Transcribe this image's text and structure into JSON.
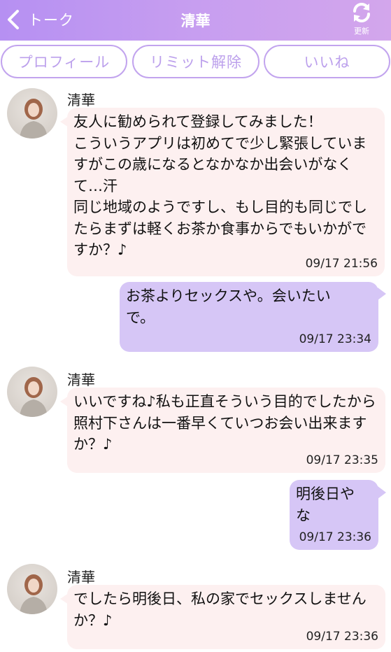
{
  "header": {
    "back_label": "トーク",
    "title": "清華",
    "refresh_label": "更新"
  },
  "tabs": {
    "profile": "プロフィール",
    "limit": "リミット解除",
    "like": "いいね"
  },
  "colors": {
    "header_gradient_start": "#b690f2",
    "header_gradient_end": "#d3a6ec",
    "incoming_bubble": "#fdf0f0",
    "outgoing_bubble": "#d6c6f6",
    "tab_border": "#c2a4ee"
  },
  "messages": [
    {
      "direction": "incoming",
      "sender": "清華",
      "text": "友人に勧められて登録してみました！\nこういうアプリは初めてで少し緊張していますがこの歳になるとなかなか出会いがなくて…汗\n同じ地域のようですし、もし目的も同じでしたらまずは軽くお茶か食事からでもいかがですか？♪",
      "time": "09/17 21:56"
    },
    {
      "direction": "outgoing",
      "text": "お茶よりセックスや。会いたいで。",
      "time": "09/17 23:34"
    },
    {
      "direction": "incoming",
      "sender": "清華",
      "text": "いいですね♪私も正直そういう目的でしたから照村下さんは一番早くていつお会い出来ますか？♪",
      "time": "09/17 23:35"
    },
    {
      "direction": "outgoing",
      "text": "明後日やな",
      "time": "09/17 23:36"
    },
    {
      "direction": "incoming",
      "sender": "清華",
      "text": "でしたら明後日、私の家でセックスしませんか？♪",
      "time": "09/17 23:36"
    }
  ]
}
